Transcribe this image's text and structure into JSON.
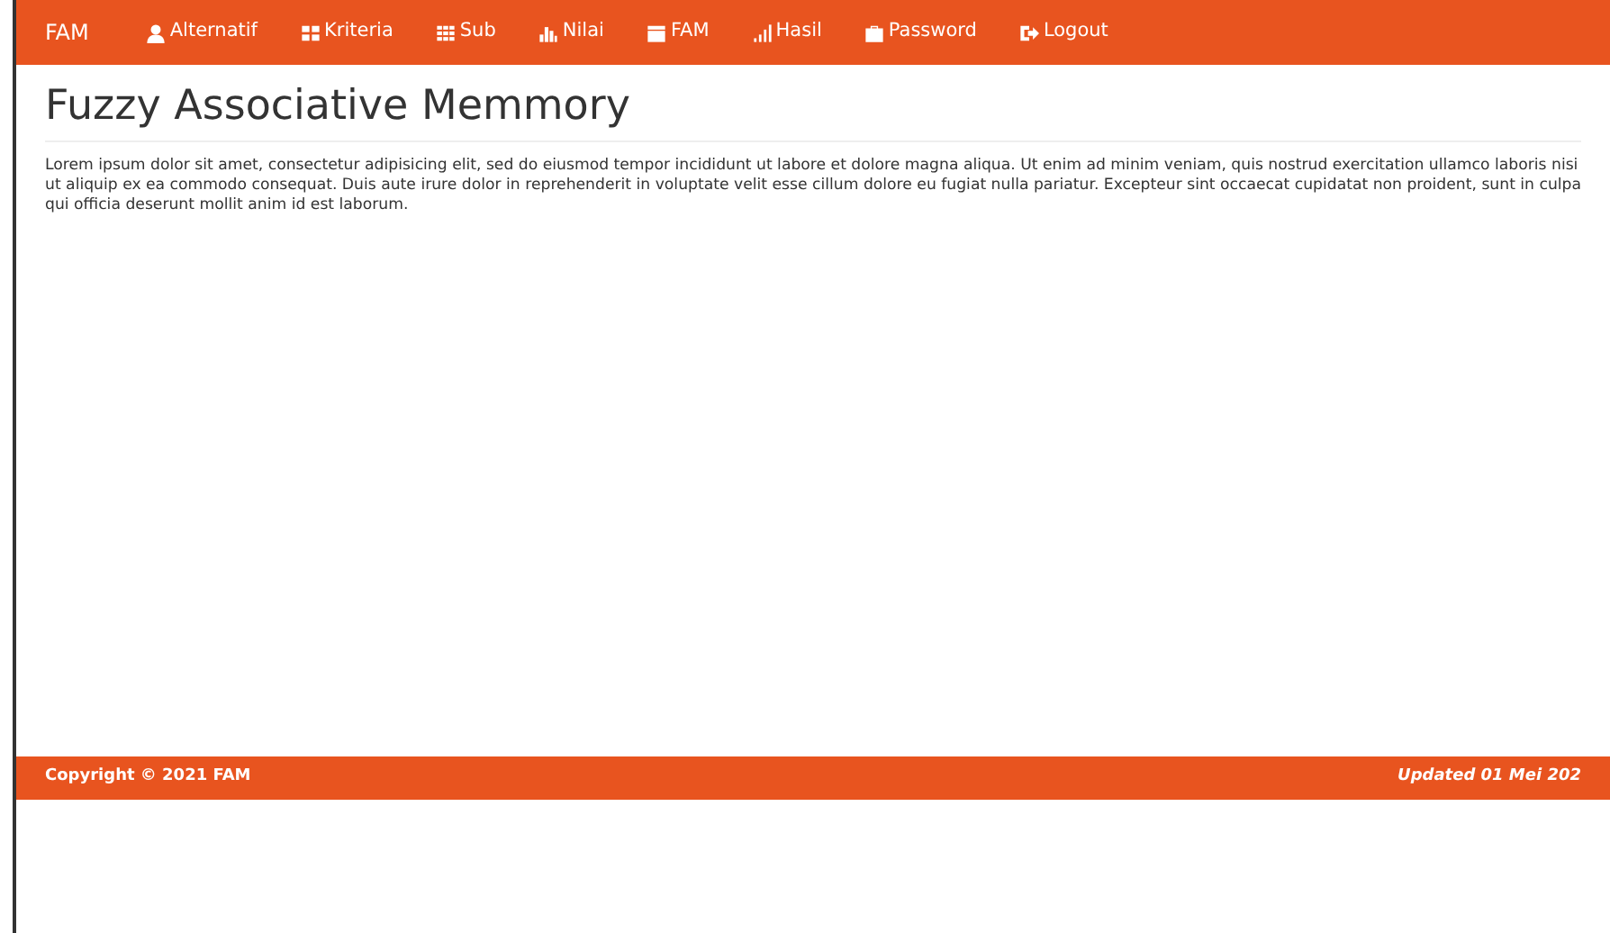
{
  "navbar": {
    "brand": "FAM",
    "items": [
      {
        "label": "Alternatif"
      },
      {
        "label": "Kriteria"
      },
      {
        "label": "Sub"
      },
      {
        "label": "Nilai"
      },
      {
        "label": "FAM"
      },
      {
        "label": "Hasil"
      },
      {
        "label": "Password"
      },
      {
        "label": "Logout"
      }
    ]
  },
  "heading": "Fuzzy Associative Memmory",
  "paragraph": "Lorem ipsum dolor sit amet, consectetur adipisicing elit, sed do eiusmod tempor incididunt ut labore et dolore magna aliqua. Ut enim ad minim veniam, quis nostrud exercitation ullamco laboris nisi ut aliquip ex ea commodo consequat. Duis aute irure dolor in reprehenderit in voluptate velit esse cillum dolore eu fugiat nulla pariatur. Excepteur sint occaecat cupidatat non proident, sunt in culpa qui officia deserunt mollit anim id est laborum.",
  "footer": {
    "copyright": "Copyright © 2021 FAM",
    "updated": "Updated 01 Mei 202"
  }
}
